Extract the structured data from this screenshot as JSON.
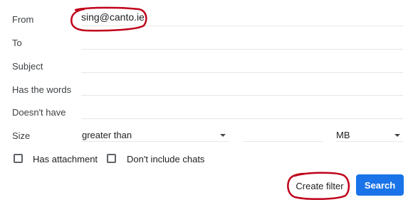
{
  "labels": {
    "from": "From",
    "to": "To",
    "subject": "Subject",
    "has_words": "Has the words",
    "doesnt_have": "Doesn't have",
    "size": "Size"
  },
  "fields": {
    "from_value": "sing@canto.ie",
    "to_value": "",
    "subject_value": "",
    "has_words_value": "",
    "doesnt_have_value": "",
    "size_number_value": ""
  },
  "size": {
    "comparator": "greater than",
    "unit": "MB"
  },
  "checkboxes": {
    "has_attachment": "Has attachment",
    "no_chats": "Don't include chats"
  },
  "buttons": {
    "create_filter": "Create filter",
    "search": "Search"
  },
  "colors": {
    "primary": "#1a73e8",
    "annotation": "#c0001a"
  }
}
